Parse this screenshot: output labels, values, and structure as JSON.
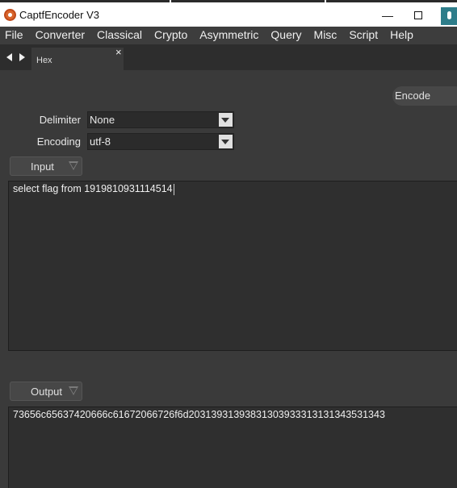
{
  "window": {
    "title": "CaptfEncoder V3",
    "minimize_glyph": "—",
    "icon": "captfencoder-logo-icon"
  },
  "menu": [
    "File",
    "Converter",
    "Classical",
    "Crypto",
    "Asymmetric",
    "Query",
    "Misc",
    "Script",
    "Help"
  ],
  "tabbar": {
    "active_tab": "Hex",
    "close_glyph": "×"
  },
  "toolbar": {
    "encode_label": "Encode"
  },
  "form": {
    "delimiter_label": "Delimiter",
    "delimiter_value": "None",
    "encoding_label": "Encoding",
    "encoding_value": "utf-8"
  },
  "input": {
    "label": "Input",
    "text": "select flag from 1919810931114514"
  },
  "output": {
    "label": "Output",
    "text": "73656c65637420666c61672066726f6d20313931393831303933313131343531343"
  },
  "colors": {
    "background": "#3a3a3a",
    "menubar": "#3d3d3d",
    "textarea": "#2f2f2f",
    "accent": "#d9652c"
  }
}
